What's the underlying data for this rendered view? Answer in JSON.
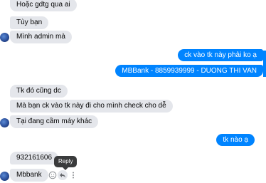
{
  "messages": [
    {
      "side": "in",
      "text": "Hoặc gdtg qua ai"
    },
    {
      "side": "in",
      "text": "Tùy bạn"
    },
    {
      "side": "in",
      "text": "Mình admin mà"
    },
    {
      "side": "out",
      "text": "ck vào tk này phải ko ạ"
    },
    {
      "side": "out",
      "text": "MBBank - 8859939999 - DUONG THI VAN"
    },
    {
      "side": "in",
      "text": "Tk đó cũng dc"
    },
    {
      "side": "in",
      "text": "Mà bạn ck vào tk này đi cho mình check cho dễ"
    },
    {
      "side": "in",
      "text": "Tại đang cầm máy khác"
    },
    {
      "side": "out",
      "text": "tk nào ạ"
    },
    {
      "side": "in",
      "text": "932161606"
    },
    {
      "side": "in",
      "text": "Mbbank"
    }
  ],
  "hover_tooltip": "Reply",
  "message_actions": {
    "react_icon": "smiley-icon",
    "reply_icon": "reply-arrow-icon",
    "more_icon": "more-dots-icon"
  },
  "colors": {
    "incoming_bg": "#e4e6eb",
    "outgoing_bg": "#0084ff",
    "outgoing_text": "#ffffff",
    "tooltip_bg": "#3a3b3c"
  }
}
